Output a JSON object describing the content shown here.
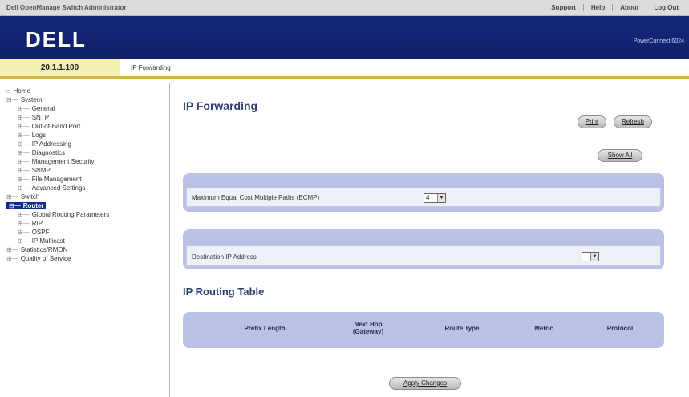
{
  "app": {
    "title": "Dell OpenManage Switch Administrator",
    "links": [
      "Support",
      "Help",
      "About",
      "Log Out"
    ],
    "logo": "DELL",
    "product": "PowerConnect 6024"
  },
  "context": {
    "ip": "20.1.1.100",
    "breadcrumb": "IP Forwarding"
  },
  "tree": {
    "root": "Home",
    "items": [
      {
        "label": "System",
        "level": 1,
        "conn": "⊟—"
      },
      {
        "label": "General",
        "level": 2,
        "conn": "⊞—"
      },
      {
        "label": "SNTP",
        "level": 2,
        "conn": "⊞—"
      },
      {
        "label": "Out-of-Band Port",
        "level": 2,
        "conn": "⊞—"
      },
      {
        "label": "Logs",
        "level": 2,
        "conn": "⊞—"
      },
      {
        "label": "IP Addressing",
        "level": 2,
        "conn": "⊞—"
      },
      {
        "label": "Diagnostics",
        "level": 2,
        "conn": "⊞—"
      },
      {
        "label": "Management Security",
        "level": 2,
        "conn": "⊞—"
      },
      {
        "label": "SNMP",
        "level": 2,
        "conn": "⊞—"
      },
      {
        "label": "File Management",
        "level": 2,
        "conn": "⊞—"
      },
      {
        "label": "Advanced Settings",
        "level": 2,
        "conn": "⊞—"
      },
      {
        "label": "Switch",
        "level": 1,
        "conn": "⊞—"
      },
      {
        "label": "Router",
        "level": 1,
        "conn": "⊟—",
        "active": true
      },
      {
        "label": "Global Routing Parameters",
        "level": 2,
        "conn": "⊞—"
      },
      {
        "label": "RIP",
        "level": 2,
        "conn": "⊞—"
      },
      {
        "label": "OSPF",
        "level": 2,
        "conn": "⊞—"
      },
      {
        "label": "IP Multicast",
        "level": 2,
        "conn": "⊞—"
      },
      {
        "label": "Statistics/RMON",
        "level": 1,
        "conn": "⊞—"
      },
      {
        "label": "Quality of Service",
        "level": 1,
        "conn": "⊞—"
      }
    ]
  },
  "main": {
    "title": "IP Forwarding",
    "buttons": {
      "print": "Print",
      "refresh": "Refresh",
      "show_all": "Show All",
      "apply": "Apply Changes"
    },
    "ecmp": {
      "label": "Maximum Equal Cost Multiple Paths (ECMP)",
      "value": "4"
    },
    "dest": {
      "label": "Destination IP Address",
      "value": ""
    },
    "routing_table": {
      "title": "IP Routing Table",
      "columns": [
        "Prefix Length",
        "Next Hop (Gateway)",
        "Route Type",
        "Metric",
        "Protocol"
      ]
    }
  }
}
